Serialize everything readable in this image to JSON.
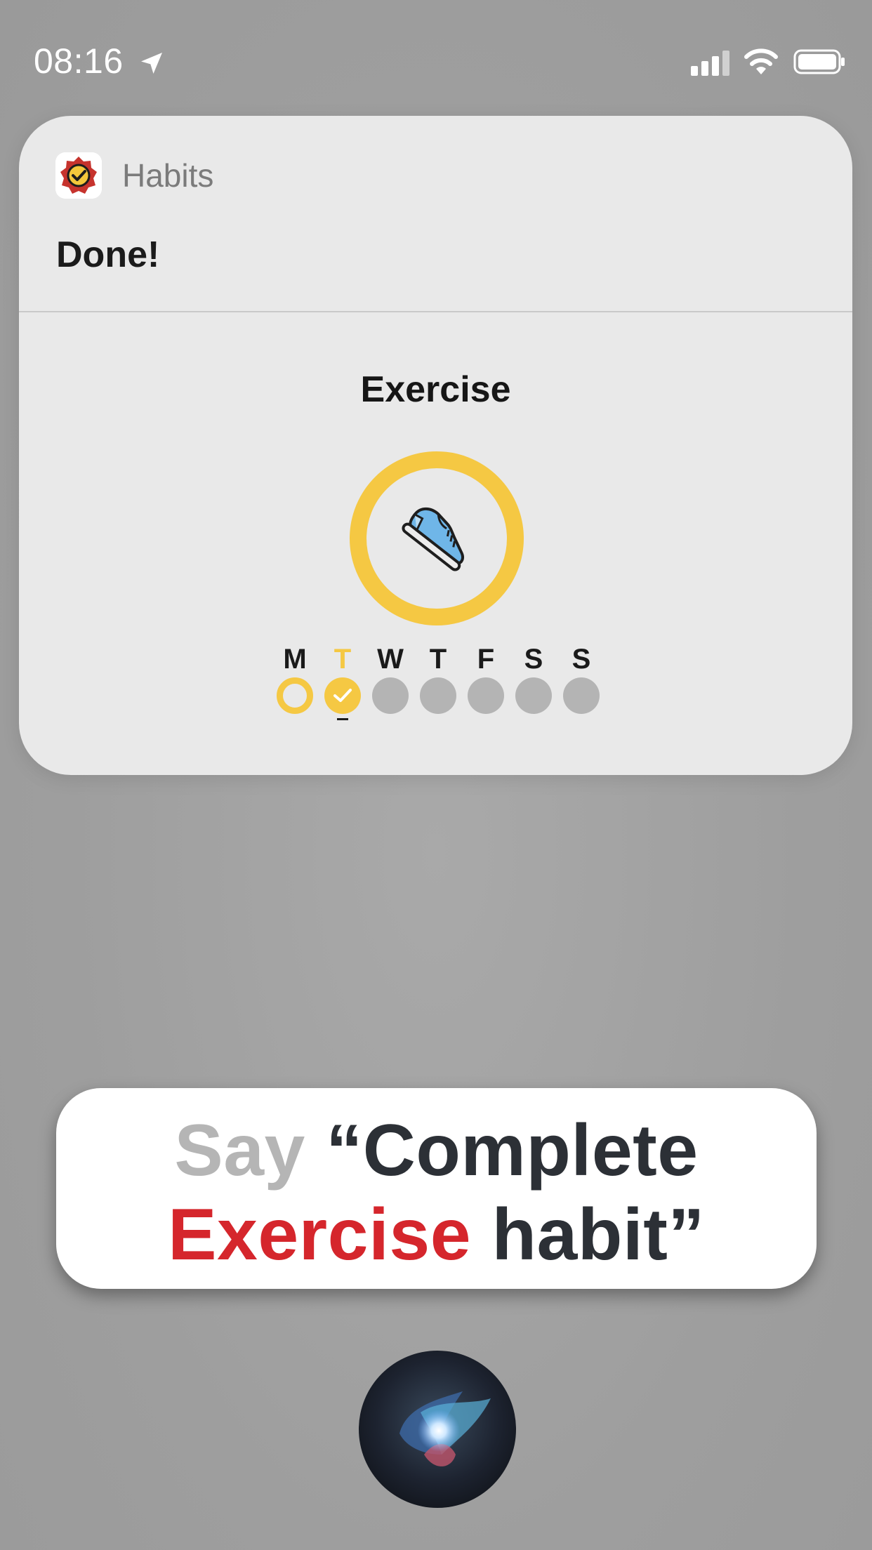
{
  "status_bar": {
    "time": "08:16"
  },
  "notification": {
    "app_name": "Habits",
    "message": "Done!"
  },
  "habit": {
    "title": "Exercise",
    "icon": "sneaker-icon",
    "ring_color": "#f5c843",
    "week": [
      {
        "label": "M",
        "state": "partial"
      },
      {
        "label": "T",
        "state": "done",
        "today": true
      },
      {
        "label": "W",
        "state": "empty"
      },
      {
        "label": "T",
        "state": "empty"
      },
      {
        "label": "F",
        "state": "empty"
      },
      {
        "label": "S",
        "state": "empty"
      },
      {
        "label": "S",
        "state": "empty"
      }
    ]
  },
  "prompt": {
    "say": "Say",
    "quote_open": "“Complete",
    "habit_name": "Exercise",
    "quote_close": "habit”"
  },
  "colors": {
    "accent": "#f5c843",
    "highlight": "#d5262c",
    "muted": "#b5b5b5"
  }
}
